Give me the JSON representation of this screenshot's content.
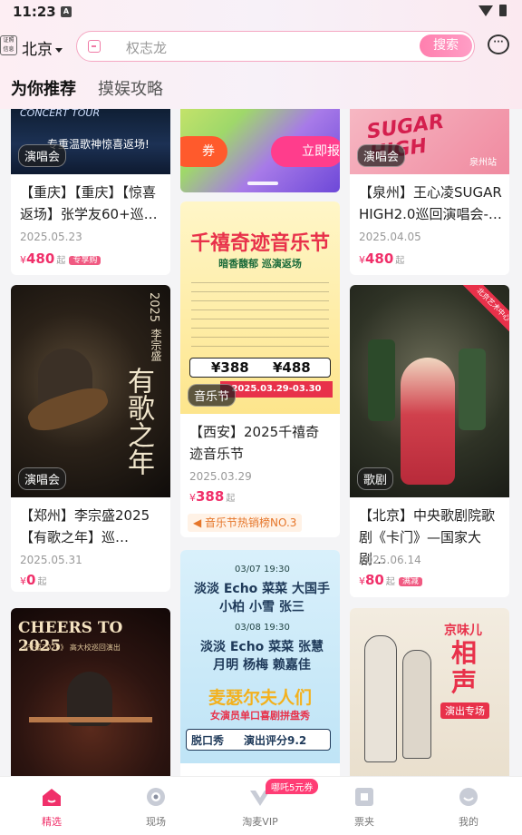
{
  "status": {
    "time": "11:23",
    "notif_icon": "a-app-icon"
  },
  "header": {
    "verify_label": "证照信息",
    "city": "北京",
    "search_placeholder": "权志龙",
    "search_button": "搜索",
    "message_icon": "chat-bubble-icon"
  },
  "tabs": [
    {
      "label": "为你推荐",
      "active": true
    },
    {
      "label": "摸娱攻略",
      "active": false
    }
  ],
  "feed": {
    "col1": [
      {
        "tag": "演唱会",
        "title": "【重庆】【重庆】【惊喜返场】张学友60+巡…",
        "date": "2025.05.23",
        "price": "480",
        "currency": "¥",
        "suffix": "起",
        "badge": "专享购",
        "poster_text": "专重温歌神惊喜返场!"
      },
      {
        "tag": "演唱会",
        "title": "【郑州】李宗盛2025【有歌之年】巡…",
        "date": "2025.05.31",
        "price": "0",
        "currency": "¥",
        "suffix": "起",
        "poster_text": "有歌之年",
        "poster_sub": "李宗盛",
        "poster_year": "2025"
      },
      {
        "title": "CHEERS TO 2025",
        "poster_sub": "《千禧2025》 高大校巡回演出"
      }
    ],
    "col2": [
      {
        "banner_left": "券",
        "banner_right": "立即报"
      },
      {
        "tag": "音乐节",
        "title": "【西安】2025千禧奇迹音乐节",
        "date": "2025.03.29",
        "price": "388",
        "currency": "¥",
        "suffix": "起",
        "hot": "音乐节热销榜NO.3",
        "poster_title": "千禧奇迹音乐节",
        "poster_sub": "暗香馥郁 巡演返场",
        "poster_price_a": "¥388",
        "poster_price_b": "¥488",
        "poster_date": "2025.03.29-03.30"
      },
      {
        "poster_title": "麦瑟尔夫人们",
        "poster_sub": "女演员单口喜剧拼盘秀",
        "poster_tag": "脱口秀",
        "poster_score": "演出评分9.2",
        "poster_lines": [
          "03/07 19:30",
          "淡淡 Echo 菜菜 大国手",
          "小柏 小雪 张三",
          "03/08 19:30",
          "淡淡 Echo 菜菜 张慧",
          "月明 杨梅 赖嘉佳"
        ]
      }
    ],
    "col3": [
      {
        "tag": "演唱会",
        "title": "【泉州】王心凌SUGAR HIGH2.0巡回演唱会-…",
        "date": "2025.04.05",
        "price": "480",
        "currency": "¥",
        "suffix": "起",
        "poster_text": "SUGAR HIGH",
        "poster_city": "泉州站"
      },
      {
        "tag": "歌剧",
        "title": "【北京】中央歌剧院歌剧《卡门》—国家大剧…",
        "date": "2025.06.14",
        "price": "80",
        "currency": "¥",
        "suffix": "起",
        "badge": "满减",
        "corner": "北京艺术中心"
      },
      {
        "poster_title": "相声",
        "poster_top": "京味儿",
        "poster_sub": "演出专场"
      }
    ]
  },
  "tabbar": [
    {
      "label": "精选",
      "icon": "home-icon",
      "active": true
    },
    {
      "label": "现场",
      "icon": "live-eye-icon",
      "active": false
    },
    {
      "label": "淘麦VIP",
      "icon": "vip-heart-icon",
      "active": false,
      "badge": "哪吒5元券"
    },
    {
      "label": "票夹",
      "icon": "ticket-icon",
      "active": false
    },
    {
      "label": "我的",
      "icon": "profile-icon",
      "active": false
    }
  ],
  "colors": {
    "accent": "#f0306a",
    "brand_pink": "#ff7fae"
  }
}
